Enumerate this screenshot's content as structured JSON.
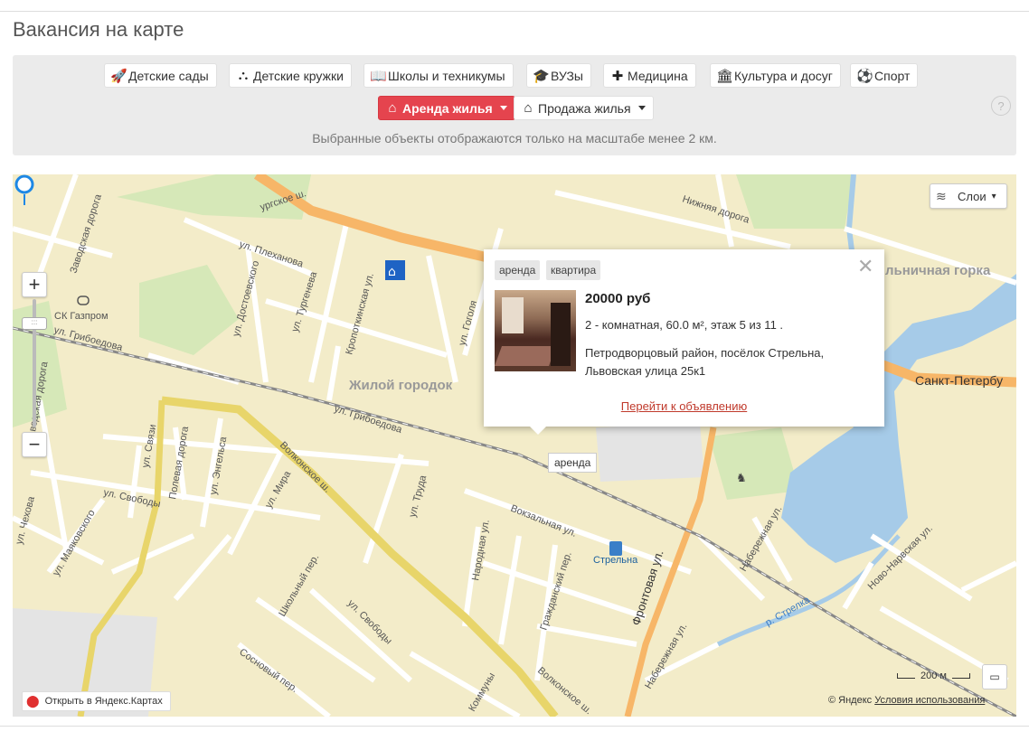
{
  "page": {
    "title": "Вакансия на карте"
  },
  "filters": {
    "categories": [
      {
        "label": "Детские сады",
        "icon": "rocket-icon",
        "glyph": "🚀"
      },
      {
        "label": "Детские кружки",
        "icon": "blocks-icon",
        "glyph": "⛬"
      },
      {
        "label": "Школы и техникумы",
        "icon": "book-icon",
        "glyph": "📖"
      },
      {
        "label": "ВУЗы",
        "icon": "graduation-cap-icon",
        "glyph": "🎓"
      },
      {
        "label": "Медицина",
        "icon": "medical-kit-icon",
        "glyph": "✚"
      },
      {
        "label": "Культура и досуг",
        "icon": "museum-icon",
        "glyph": "🏛"
      },
      {
        "label": "Спорт",
        "icon": "soccer-ball-icon",
        "glyph": "⚽"
      }
    ],
    "rent": {
      "label": "Аренда жилья",
      "icon": "house-clock-icon",
      "glyph": "⌂",
      "active": true
    },
    "sale": {
      "label": "Продажа жилья",
      "icon": "house-sale-icon",
      "glyph": "⌂"
    },
    "note": "Выбранные объекты отображаются только на масштабе менее 2 км.",
    "help": "?"
  },
  "map": {
    "layers_label": "Слои",
    "zoom_in": "+",
    "zoom_out": "−",
    "labels": {
      "road_top": "ургское ш.",
      "nizhnyaya": "Нижняя дорога",
      "zavodskaya": "Заводская дорога",
      "plekhanova": "ул. Плеханова",
      "turgeneva": "ул. Тургенева",
      "dostoevskogo": "ул. Достоевского",
      "kropotkinskaya": "Кропоткинская ул.",
      "gogolya": "ул. Гоголя",
      "griboedova1": "ул. Грибоедова",
      "griboedova2": "ул. Грибоедова",
      "gazprom": "СК Газпром",
      "zhiloy": "Жилой городок",
      "volnichnaya": "льничная горка",
      "spb": "Санкт-Петербу",
      "svyazi1": "ул. Связи",
      "polevaya": "Полевая дорога",
      "engelsa": "ул. Энгельса",
      "mira": "ул. Мира",
      "truda": "ул. Труда",
      "svobody1": "ул. Свободы",
      "chekhova": "ул. Чехова",
      "mayakovskogo": "ул. Маяковского",
      "volkonskoe1": "Волконское ш.",
      "vokzalnaya": "Вокзальная ул.",
      "narodnaya": "Народная ул.",
      "grazhdanskiy": "Гражданский пер.",
      "frontovaya": "Фронтовая ул.",
      "naberezhnaya1": "Набережная ул.",
      "naberezhnaya2": "Набережная ул.",
      "novonarvskaya": "Ново-Нарвская ул.",
      "shkolny": "Школьный пер.",
      "svobody2": "ул. Свободы",
      "sosnovy": "Сосновый пер.",
      "volkonskoe2": "Волконское ш.",
      "kommuny": "Коммуны",
      "strelka": "р. Стрелка",
      "zavodskaya2": "водская дорога",
      "streltsy": "Стрельна"
    },
    "station": "Стрельна",
    "hint": "аренда",
    "open_yandex": "Открыть в Яндекс.Картах",
    "copyright": "© Яндекс",
    "terms": "Условия использования",
    "scale": "200 м"
  },
  "balloon": {
    "tags": [
      "аренда",
      "квартира"
    ],
    "price": "20000 руб",
    "description": "2 - комнатная, 60.0 м², этаж 5 из 11 .",
    "address": "Петродворцовый район, посёлок Стрельна, Львовская улица 25к1",
    "link": "Перейти к объявлению"
  },
  "colors": {
    "accent": "#e5444e",
    "map_bg": "#f3ecc9",
    "water": "#a6cbe8",
    "road_major": "#f7b668"
  }
}
